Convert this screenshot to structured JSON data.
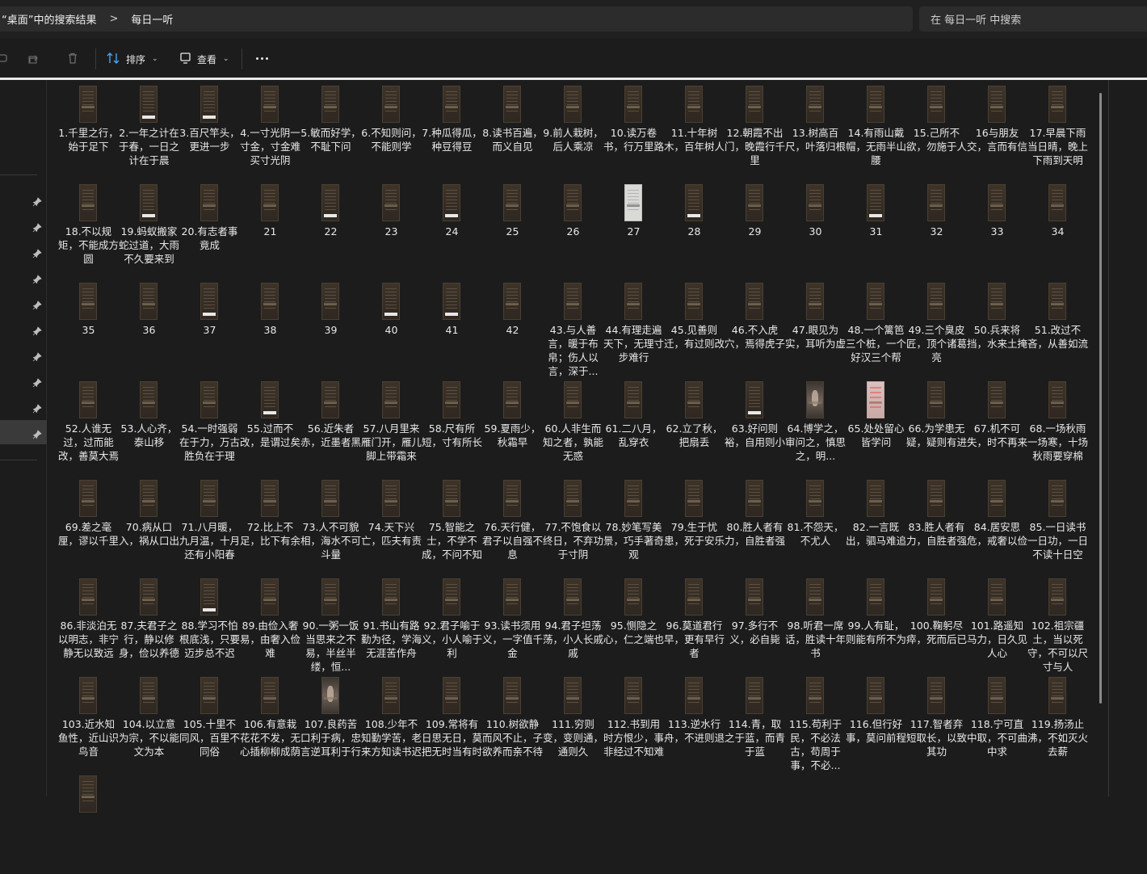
{
  "breadcrumb": {
    "first": "“桌面”中的搜索结果",
    "separator": ">",
    "second": "每日一听"
  },
  "search": {
    "placeholder": "在 每日一听 中搜索"
  },
  "toolbar": {
    "sort_label": "排序",
    "view_label": "查看"
  },
  "files": [
    "1.千里之行，始于足下",
    "2.一年之计在于春，一日之计在于晨",
    "3.百尺竿头，更进一步",
    "4.一寸光阴一寸金，寸金难买寸光阴",
    "5.敏而好学，不耻下问",
    "6.不知则问，不能则学",
    "7.种瓜得瓜，种豆得豆",
    "8.读书百遍，而义自见",
    "9.前人栽树，后人乘凉",
    "10.读万卷书，行万里路",
    "11.十年树木，百年树人",
    "12.朝霞不出门，晚霞行千里",
    "13.树高百尺，叶落归根",
    "14.有雨山戴帽，无雨半山腰",
    "15.己所不欲，勿施于人",
    "16与朋友交，言而有信",
    "17.早晨下雨当日晴，晚上下雨到天明",
    "18.不以规矩，不能成方圆",
    "19.蚂蚁搬家蛇过道，大雨不久要来到",
    "20.有志者事竟成",
    "21",
    "22",
    "23",
    "24",
    "25",
    "26",
    "27",
    "28",
    "29",
    "30",
    "31",
    "32",
    "33",
    "34",
    "35",
    "36",
    "37",
    "38",
    "39",
    "40",
    "41",
    "42",
    "43.与人善言，暖于布帛；伤人以言，深于...",
    "44.有理走遍天下，无理寸步难行",
    "45.见善则迁，有过则改",
    "46.不入虎穴，焉得虎子",
    "47.眼见为实，耳听为虚",
    "48.一个篱笆三个桩，一个好汉三个帮",
    "49.三个臭皮匠，顶个诸葛亮",
    "50.兵来将挡，水来土掩",
    "51.改过不吝，从善如流",
    "52.人谁无过，过而能改，善莫大焉",
    "53.人心齐，泰山移",
    "54.一时强弱在于力，万古胜负在于理",
    "55.过而不改，是谓过矣",
    "56.近朱者赤，近墨者黑",
    "57.八月里来雁门开，雁儿脚上带霜来",
    "58.尺有所短，寸有所长",
    "59.夏雨少，秋霜早",
    "60.人非生而知之者，孰能无惑",
    "61.二八月，乱穿衣",
    "62.立了秋，把扇丢",
    "63.好问则裕，自用则小",
    "64.博学之，审问之，慎思之，明...",
    "65.处处留心皆学问",
    "66.为学患无疑，疑则有进",
    "67.机不可失，时不再来",
    "68.一场秋雨一场寒，十场秋雨要穿棉",
    "69.差之毫厘，谬以千里",
    "70.病从口入，祸从口出",
    "71.八月暖，九月温，十月还有小阳春",
    "72.比上不足，比下有余",
    "73.人不可貌相，海水不可斗量",
    "74.天下兴亡，匹夫有责",
    "75.智能之士，不学不成，不问不知",
    "76.天行健，君子以自强不息",
    "77.不饱食以终日，不弃功于寸阴",
    "78.妙笔写美景，巧手著奇观",
    "79.生于忧患，死于安乐",
    "80.胜人者有力，自胜者强",
    "81.不怨天，不尤人",
    "82.一言既出，驷马难追",
    "83.胜人者有力，自胜者强",
    "84.居安思危，戒奢以俭",
    "85.一日读书一日功，一日不读十日空",
    "86.非淡泊无以明志，非宁静无以致远",
    "87.夫君子之行，静以修身，俭以养德",
    "88.学习不怕根底浅，只要迈步总不迟",
    "89.由俭入奢易，由奢入俭难",
    "90.一粥一饭当思来之不易，半丝半缕，恒...",
    "91.书山有路勤为径，学海无涯苦作舟",
    "92.君子喻于义，小人喻于利",
    "93.读书须用义，一字值千金",
    "94.君子坦荡荡，小人长戚戚",
    "95.恻隐之心，仁之端也",
    "96.莫道君行早，更有早行者",
    "97.多行不义，必自毙",
    "98.听君一席话，胜读十年书",
    "99.人有耻，则能有所不为",
    "100.鞠躬尽瘁，死而后已",
    "101.路遥知马力，日久见人心",
    "102.祖宗疆土，当以死守，不可以尺寸与人",
    "103.近水知鱼性，近山识鸟音",
    "104.以立意为宗，不以能文为本",
    "105.十里不同风，百里不同俗",
    "106.有意栽花花不发，无心插柳柳成荫",
    "107.良药苦口利于病，忠言逆耳利于行",
    "108.少年不知勤学苦，老来方知读书迟",
    "109.常将有日思无日，莫把无时当有时",
    "110.树欲静而风不止，子欲养而亲不待",
    "111.穷则变，变则通，通则久",
    "112.书到用时方恨少，事非经过不知难",
    "113.逆水行舟，不进则退",
    "114.青，取之于蓝，而青于蓝",
    "115.苟利于民，不必法古，苟周于事，不必...",
    "116.但行好事，莫问前程",
    "117.智者弃短取长，以致其功",
    "118.宁可直中取，不可曲中求",
    "119.扬汤止沸，不如灭火去薪",
    ""
  ]
}
